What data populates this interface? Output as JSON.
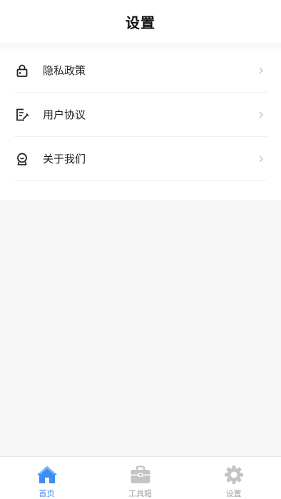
{
  "header": {
    "title": "设置"
  },
  "menu": {
    "items": [
      {
        "label": "隐私政策",
        "icon": "lock-icon"
      },
      {
        "label": "用户协议",
        "icon": "edit-document-icon"
      },
      {
        "label": "关于我们",
        "icon": "person-badge-icon"
      }
    ]
  },
  "tabbar": {
    "active_color": "#3c8ef0",
    "inactive_color": "#a3a3a3",
    "tabs": [
      {
        "label": "首页",
        "icon": "home-icon",
        "active": true
      },
      {
        "label": "工具箱",
        "icon": "toolbox-icon",
        "active": false
      },
      {
        "label": "设置",
        "icon": "gear-icon",
        "active": false
      }
    ]
  }
}
